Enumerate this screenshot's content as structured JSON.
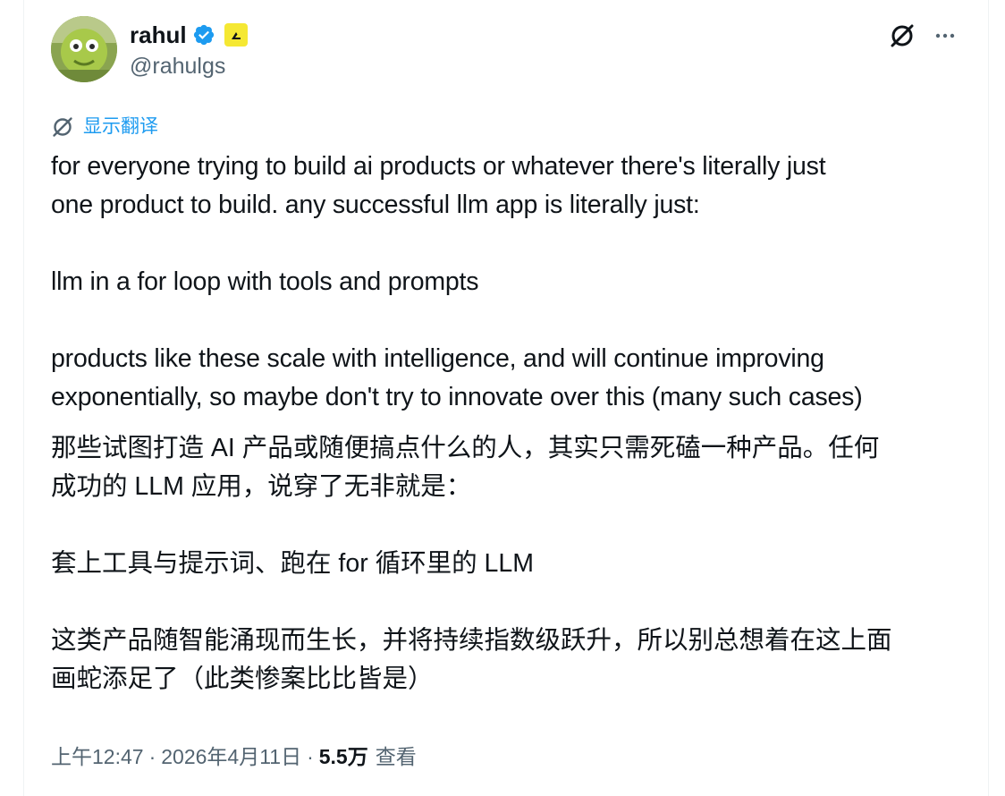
{
  "author": {
    "display_name": "rahul",
    "handle": "@rahulgs"
  },
  "translate": {
    "label": "显示翻译"
  },
  "tweet": {
    "original_lines": [
      "for everyone trying to build ai products or whatever there's literally just",
      "one product to build. any successful llm app is literally just:",
      "",
      "llm in a for loop with tools and prompts",
      "",
      "products like these scale with intelligence, and will continue improving",
      "exponentially, so maybe don't try to innovate over this (many such cases)"
    ],
    "p1_l1": "for everyone trying to build ai products or whatever there's literally just",
    "p1_l2": "one product to build. any successful llm app is literally just:",
    "p2": "llm in a for loop with tools and prompts",
    "p3_l1": "products like these scale with intelligence, and will continue improving",
    "p3_l2": "exponentially, so maybe don't try to innovate over this (many such cases)",
    "zh_p1_l1": "那些试图打造 AI 产品或随便搞点什么的人，其实只需死磕一种产品。任何",
    "zh_p1_l2": "成功的 LLM 应用，说穿了无非就是：",
    "zh_p2": "套上工具与提示词、跑在 for 循环里的 LLM",
    "zh_p3_l1": "这类产品随智能涌现而生长，并将持续指数级跃升，所以别总想着在这上面",
    "zh_p3_l2": "画蛇添足了（此类惨案比比皆是）"
  },
  "meta": {
    "time": "上午12:47",
    "separator": "·",
    "date": "2026年4月11日",
    "views_count": "5.5万",
    "views_label": "查看"
  },
  "colors": {
    "accent": "#1d9bf0",
    "text": "#0f1419",
    "secondary": "#536471",
    "affiliate_badge": "#f5e833"
  }
}
